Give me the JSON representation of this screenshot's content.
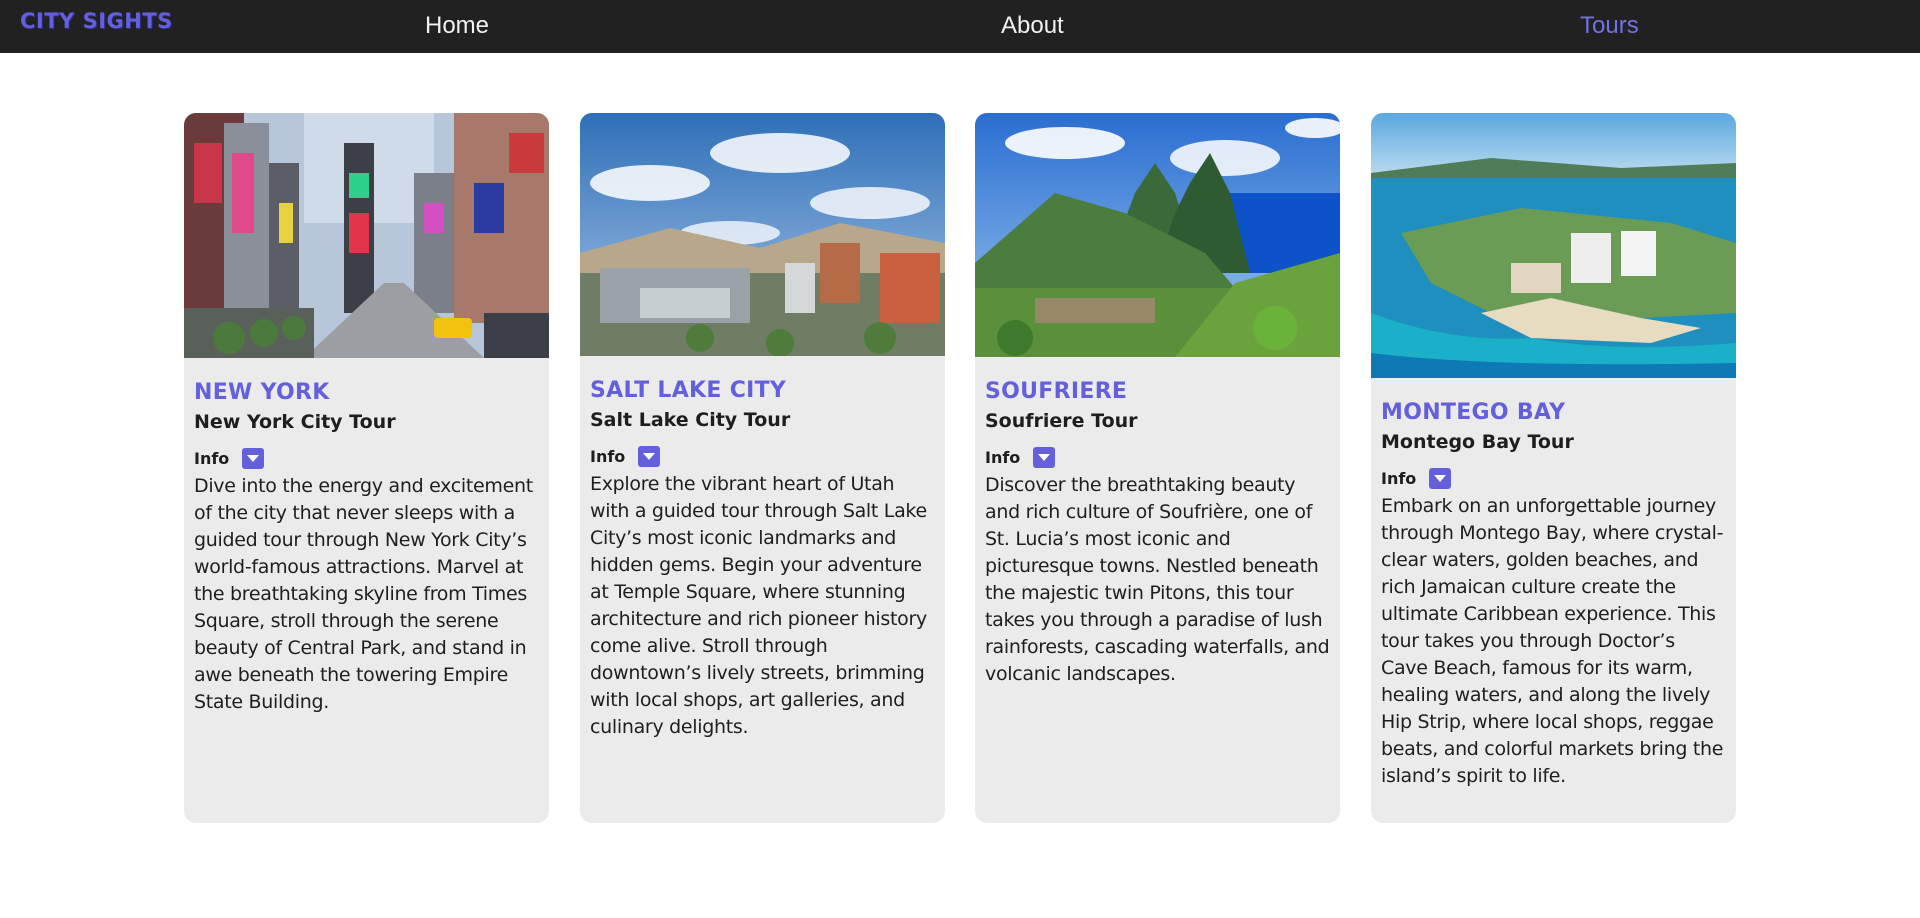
{
  "nav": {
    "brand": "CITY SIGHTS",
    "links": [
      "Home",
      "About",
      "Tours"
    ],
    "active_color": "#7470e8"
  },
  "cards": [
    {
      "city": "NEW YORK",
      "tour": "New York City Tour",
      "info_label": "Info",
      "description": "Dive into the energy and excitement of the city that never sleeps with a guided tour through New York City’s world-famous attractions. Marvel at the breathtaking skyline from Times Square, stroll through the serene beauty of Central Park, and stand in awe beneath the towering Empire State Building."
    },
    {
      "city": "SALT LAKE CITY",
      "tour": "Salt Lake City Tour",
      "info_label": "Info",
      "description": "Explore the vibrant heart of Utah with a guided tour through Salt Lake City’s most iconic landmarks and hidden gems. Begin your adventure at Temple Square, where stunning architecture and rich pioneer history come alive. Stroll through downtown’s lively streets, brimming with local shops, art galleries, and culinary delights."
    },
    {
      "city": "SOUFRIERE",
      "tour": "Soufriere Tour",
      "info_label": "Info",
      "description": "Discover the breathtaking beauty and rich culture of Soufrière, one of St. Lucia’s most iconic and picturesque towns. Nestled beneath the majestic twin Pitons, this tour takes you through a paradise of lush rainforests, cascading waterfalls, and volcanic landscapes."
    },
    {
      "city": "MONTEGO BAY",
      "tour": "Montego Bay Tour",
      "info_label": "Info",
      "description": "Embark on an unforgettable journey through Montego Bay, where crystal-clear waters, golden beaches, and rich Jamaican culture create the ultimate Caribbean experience. This tour takes you through Doctor’s Cave Beach, famous for its warm, healing waters, and along the lively Hip Strip, where local shops, reggae beats, and colorful markets bring the island’s spirit to life."
    }
  ]
}
